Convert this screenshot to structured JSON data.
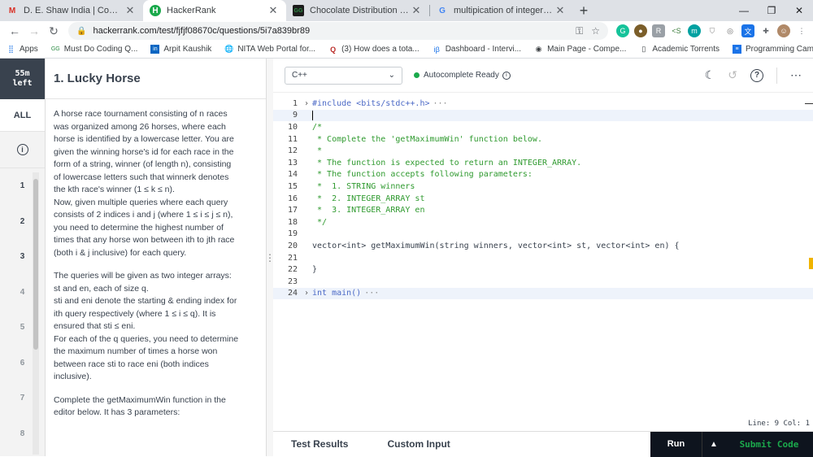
{
  "tabs": [
    {
      "title": "D. E. Shaw India | Computational",
      "favicon": "M",
      "favicon_color": "#d93025"
    },
    {
      "title": "HackerRank",
      "favicon": "H",
      "favicon_color": "#1ba94c"
    },
    {
      "title": "Chocolate Distribution Problem -",
      "favicon": "GG",
      "favicon_color": "#2f8d46"
    },
    {
      "title": "multipication of integer is equal",
      "favicon": "G",
      "favicon_color": "#4285f4"
    }
  ],
  "window_controls": {
    "minimize": "—",
    "restore": "❐",
    "close": "✕"
  },
  "address": {
    "url": "hackerrank.com/test/fjfjf08670c/questions/5i7a839br89"
  },
  "bookmarks": [
    {
      "label": "Apps",
      "icon": "apps-icon"
    },
    {
      "label": "Must Do Coding Q...",
      "icon": "gfg-icon"
    },
    {
      "label": "Arpit Kaushik",
      "icon": "linkedin-icon"
    },
    {
      "label": "NITA Web Portal for...",
      "icon": "globe-icon"
    },
    {
      "label": "(3) How does a tota...",
      "icon": "quora-icon"
    },
    {
      "label": "Dashboard - Intervi...",
      "icon": "interviewbit-icon"
    },
    {
      "label": "Main Page - Compe...",
      "icon": "wiki-icon"
    },
    {
      "label": "Academic Torrents",
      "icon": "doc-icon"
    },
    {
      "label": "Programming Cam...",
      "icon": "sheet-icon"
    }
  ],
  "timer": {
    "value": "55m",
    "suffix": "left"
  },
  "nav": {
    "all": "ALL",
    "questions": [
      "1",
      "2",
      "3",
      "4",
      "5",
      "6",
      "7",
      "8"
    ]
  },
  "problem": {
    "title": "1. Lucky Horse",
    "p1": "A horse race tournament consisting of n races was organized among 26 horses, where each horse is identified by a lowercase letter. You are given the winning horse's id for each race in the form of a string, winner (of length n), consisting of lowercase letters such that winnerk denotes the kth race's winner (1 ≤ k ≤ n).",
    "p2": "Now, given multiple queries where each query consists of 2 indices i and j (where 1 ≤ i ≤ j ≤ n), you need to determine the highest number of times that any horse won between ith to jth race (both i & j inclusive) for each query.",
    "p3": "The queries will be given as two integer arrays: st and en, each of size q.",
    "p4": "sti and eni denote the starting & ending index for ith query respectively (where 1 ≤ i ≤ q). It is ensured that sti ≤ eni.",
    "p5": "For each of the q queries, you need to determine the maximum number of times a horse won between race sti to race eni (both indices inclusive).",
    "p6": "Complete the getMaximumWin function in the editor below. It has 3 parameters:"
  },
  "editor": {
    "language": "C++",
    "autocomplete": "Autocomplete Ready",
    "status": "Line: 9 Col: 1",
    "lines": [
      {
        "n": "1",
        "fold": "›",
        "text": "#include <bits/stdc++.h>",
        "cls": "pp",
        "ellipsis": "···"
      },
      {
        "n": "9",
        "fold": "",
        "text": "",
        "cls": "txt",
        "ellipsis": ""
      },
      {
        "n": "10",
        "fold": "",
        "text": "/*",
        "cls": "cm",
        "ellipsis": ""
      },
      {
        "n": "11",
        "fold": "",
        "text": " * Complete the 'getMaximumWin' function below.",
        "cls": "cm",
        "ellipsis": ""
      },
      {
        "n": "12",
        "fold": "",
        "text": " *",
        "cls": "cm",
        "ellipsis": ""
      },
      {
        "n": "13",
        "fold": "",
        "text": " * The function is expected to return an INTEGER_ARRAY.",
        "cls": "cm",
        "ellipsis": ""
      },
      {
        "n": "14",
        "fold": "",
        "text": " * The function accepts following parameters:",
        "cls": "cm",
        "ellipsis": ""
      },
      {
        "n": "15",
        "fold": "",
        "text": " *  1. STRING winners",
        "cls": "cm",
        "ellipsis": ""
      },
      {
        "n": "16",
        "fold": "",
        "text": " *  2. INTEGER_ARRAY st",
        "cls": "cm",
        "ellipsis": ""
      },
      {
        "n": "17",
        "fold": "",
        "text": " *  3. INTEGER_ARRAY en",
        "cls": "cm",
        "ellipsis": ""
      },
      {
        "n": "18",
        "fold": "",
        "text": " */",
        "cls": "cm",
        "ellipsis": ""
      },
      {
        "n": "19",
        "fold": "",
        "text": "",
        "cls": "txt",
        "ellipsis": ""
      },
      {
        "n": "20",
        "fold": "",
        "text": "vector<int> getMaximumWin(string winners, vector<int> st, vector<int> en) {",
        "cls": "txt",
        "ellipsis": ""
      },
      {
        "n": "21",
        "fold": "",
        "text": "",
        "cls": "txt",
        "ellipsis": ""
      },
      {
        "n": "22",
        "fold": "",
        "text": "}",
        "cls": "txt",
        "ellipsis": ""
      },
      {
        "n": "23",
        "fold": "",
        "text": "",
        "cls": "txt",
        "ellipsis": ""
      },
      {
        "n": "24",
        "fold": "›",
        "text": "int main()",
        "cls": "kw",
        "ellipsis": "···"
      }
    ]
  },
  "bottom": {
    "test_results": "Test Results",
    "custom_input": "Custom Input",
    "run": "Run",
    "submit": "Submit Code"
  },
  "colors": {
    "accent_green": "#1ba94c",
    "dark": "#0e141e",
    "text": "#39424e"
  }
}
